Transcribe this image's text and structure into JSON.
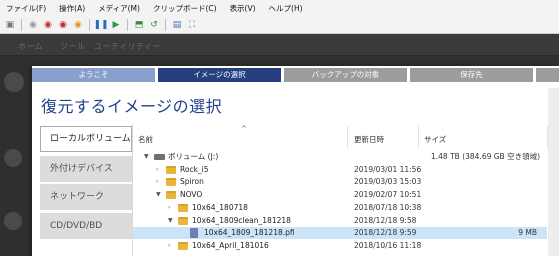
{
  "menubar": {
    "items": [
      "ファイル(F)",
      "操作(A)",
      "メディア(M)",
      "クリップボード(C)",
      "表示(V)",
      "ヘルプ(H)"
    ]
  },
  "toolbar": {
    "icons": [
      "ctrl-alt-del-icon",
      "start-icon",
      "turn-off-icon",
      "shutdown-icon",
      "pause-icon",
      "resume-icon",
      "checkpoint-icon",
      "revert-icon",
      "enhanced-session-icon",
      "zoom-icon"
    ]
  },
  "guest": {
    "tabs": [
      "ホーム",
      "ツール",
      "ユーティリティー"
    ]
  },
  "wizard": {
    "steps": [
      "ようこそ",
      "イメージの選択",
      "バックアップの対象",
      "保存先"
    ],
    "active_step": 1,
    "title": "復元するイメージの選択"
  },
  "sources": [
    "ローカルボリューム",
    "外付けデバイス",
    "ネットワーク",
    "CD/DVD/BD"
  ],
  "selected_source": 0,
  "tree": {
    "columns": {
      "name": "名前",
      "modified": "更新日時",
      "size": "サイズ"
    },
    "rows": [
      {
        "name": "ボリューム (J:)",
        "date": "",
        "size": "1.48 TB (384.69 GB 空き領域)",
        "level": 0,
        "expander": "▼",
        "icon": "drive",
        "selected": false
      },
      {
        "name": "Rock_i5",
        "date": "2019/03/01 11:56",
        "size": "",
        "level": 1,
        "expander": "›",
        "icon": "folder",
        "selected": false
      },
      {
        "name": "Spiron",
        "date": "2019/03/03 15:03",
        "size": "",
        "level": 1,
        "expander": "›",
        "icon": "folder",
        "selected": false
      },
      {
        "name": "NOVO",
        "date": "2019/02/07 10:51",
        "size": "",
        "level": 1,
        "expander": "▼",
        "icon": "folder",
        "selected": false
      },
      {
        "name": "10x64_180718",
        "date": "2018/07/18 10:38",
        "size": "",
        "level": 2,
        "expander": "›",
        "icon": "folder",
        "selected": false
      },
      {
        "name": "10x64_1809clean_181218",
        "date": "2018/12/18 9:58",
        "size": "",
        "level": 2,
        "expander": "▼",
        "icon": "folder",
        "selected": false
      },
      {
        "name": "10x64_1809_181218.pfi",
        "date": "2018/12/18 9:59",
        "size": "9 MB",
        "level": 3,
        "expander": "",
        "icon": "file",
        "selected": true
      },
      {
        "name": "10x64_April_181016",
        "date": "2018/10/16 11:18",
        "size": "",
        "level": 2,
        "expander": "›",
        "icon": "folder",
        "selected": false
      }
    ]
  }
}
